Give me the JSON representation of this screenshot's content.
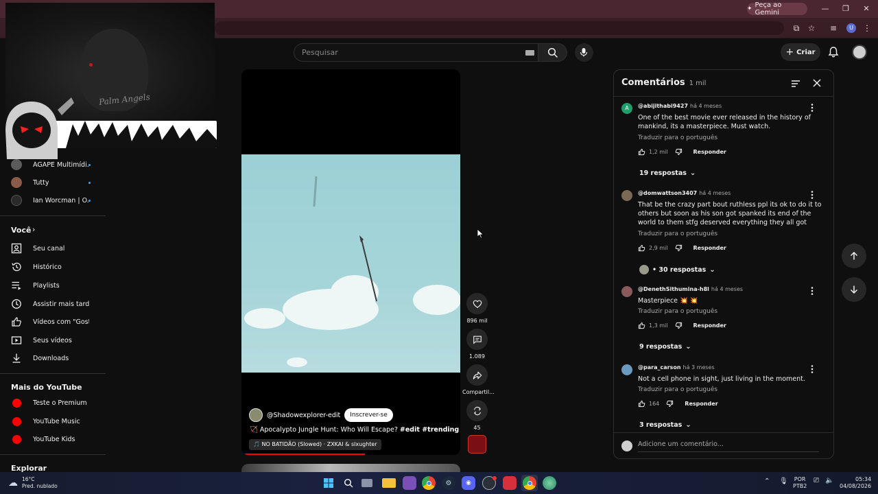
{
  "browser": {
    "gemini_button": "Peça ao Gemini",
    "profile_initial": "U"
  },
  "webcam": {
    "shirt_text": "Palm Angels"
  },
  "header": {
    "search_placeholder": "Pesquisar",
    "create_label": "Criar"
  },
  "sidebar": {
    "subscriptions": [
      {
        "name": "ÁGAPE Multimídi...",
        "avatar_color": "#5a5a5a"
      },
      {
        "name": "Tutty",
        "avatar_color": "#8a5a4a"
      },
      {
        "name": "Ian Worcman | O...",
        "avatar_color": "#2a2a2a"
      }
    ],
    "you_section": {
      "title": "Você",
      "items": [
        {
          "label": "Seu canal",
          "icon": "account-box-icon"
        },
        {
          "label": "Histórico",
          "icon": "history-icon"
        },
        {
          "label": "Playlists",
          "icon": "playlists-icon"
        },
        {
          "label": "Assistir mais tarde",
          "icon": "watch-later-icon"
        },
        {
          "label": "Vídeos com \"Gostei\"",
          "icon": "thumb-up-icon"
        },
        {
          "label": "Seus vídeos",
          "icon": "your-videos-icon"
        },
        {
          "label": "Downloads",
          "icon": "download-icon"
        }
      ]
    },
    "more_section": {
      "title": "Mais do YouTube",
      "items": [
        {
          "label": "Teste o Premium p..."
        },
        {
          "label": "YouTube Music"
        },
        {
          "label": "YouTube Kids"
        }
      ]
    },
    "explore_title": "Explorar"
  },
  "short": {
    "channel": "@Shadowexplorer-edit",
    "subscribe_label": "Inscrever-se",
    "title_prefix": "🏹 Apocalypto Jungle Hunt: Who Will Escape?",
    "hashtags": "#edit #trending",
    "music": "🎵 NO BATIDÃO (Slowed) · ZXKAI & slxughter"
  },
  "actions": {
    "likes": "896 mil",
    "comments": "1.089",
    "share": "Compartil...",
    "remix": "45"
  },
  "comments_panel": {
    "title": "Comentários",
    "count": "1 mil",
    "translate_label": "Traduzir para o português",
    "reply_label": "Responder",
    "add_placeholder": "Adicione um comentário...",
    "items": [
      {
        "author": "@abijithabi9427",
        "time": "há 4 meses",
        "avatar_letter": "A",
        "avatar_color": "#1e9e6a",
        "text": "One of the best movie ever released in the history of mankind, its a masterpiece. Must watch.",
        "likes": "1,2 mil",
        "replies": "19 respostas"
      },
      {
        "author": "@domwattson3407",
        "time": "há 4 meses",
        "avatar_letter": "",
        "avatar_color": "#7a6a55",
        "text": "That be the crazy part bout ruthless ppl its ok to do it to others but soon as his son got spanked its end of the world to them stfg deserved everything they all got",
        "likes": "2,9 mil",
        "replies": "• 30 respostas"
      },
      {
        "author": "@DenethSithumina-h8l",
        "time": "há 4 meses",
        "avatar_letter": "",
        "avatar_color": "#8a5a5a",
        "text": "Masterpiece 💥 💥",
        "likes": "1,3 mil",
        "replies": "9 respostas"
      },
      {
        "author": "@para_carson",
        "time": "há 3 meses",
        "avatar_letter": "",
        "avatar_color": "#6a9ac0",
        "text": "Not a cell phone in sight, just living in the moment.",
        "likes": "164",
        "replies": "3 respostas"
      }
    ]
  },
  "taskbar": {
    "weather_temp": "16°C",
    "weather_desc": "Pred. nublado",
    "lang_top": "POR",
    "lang_bottom": "PTB2",
    "time": "05:34",
    "date": "04/08/2026"
  },
  "colors": {
    "accent_red": "#ff0000",
    "link_blue": "#3ea6ff",
    "chrome_tab": "#4a2630"
  }
}
